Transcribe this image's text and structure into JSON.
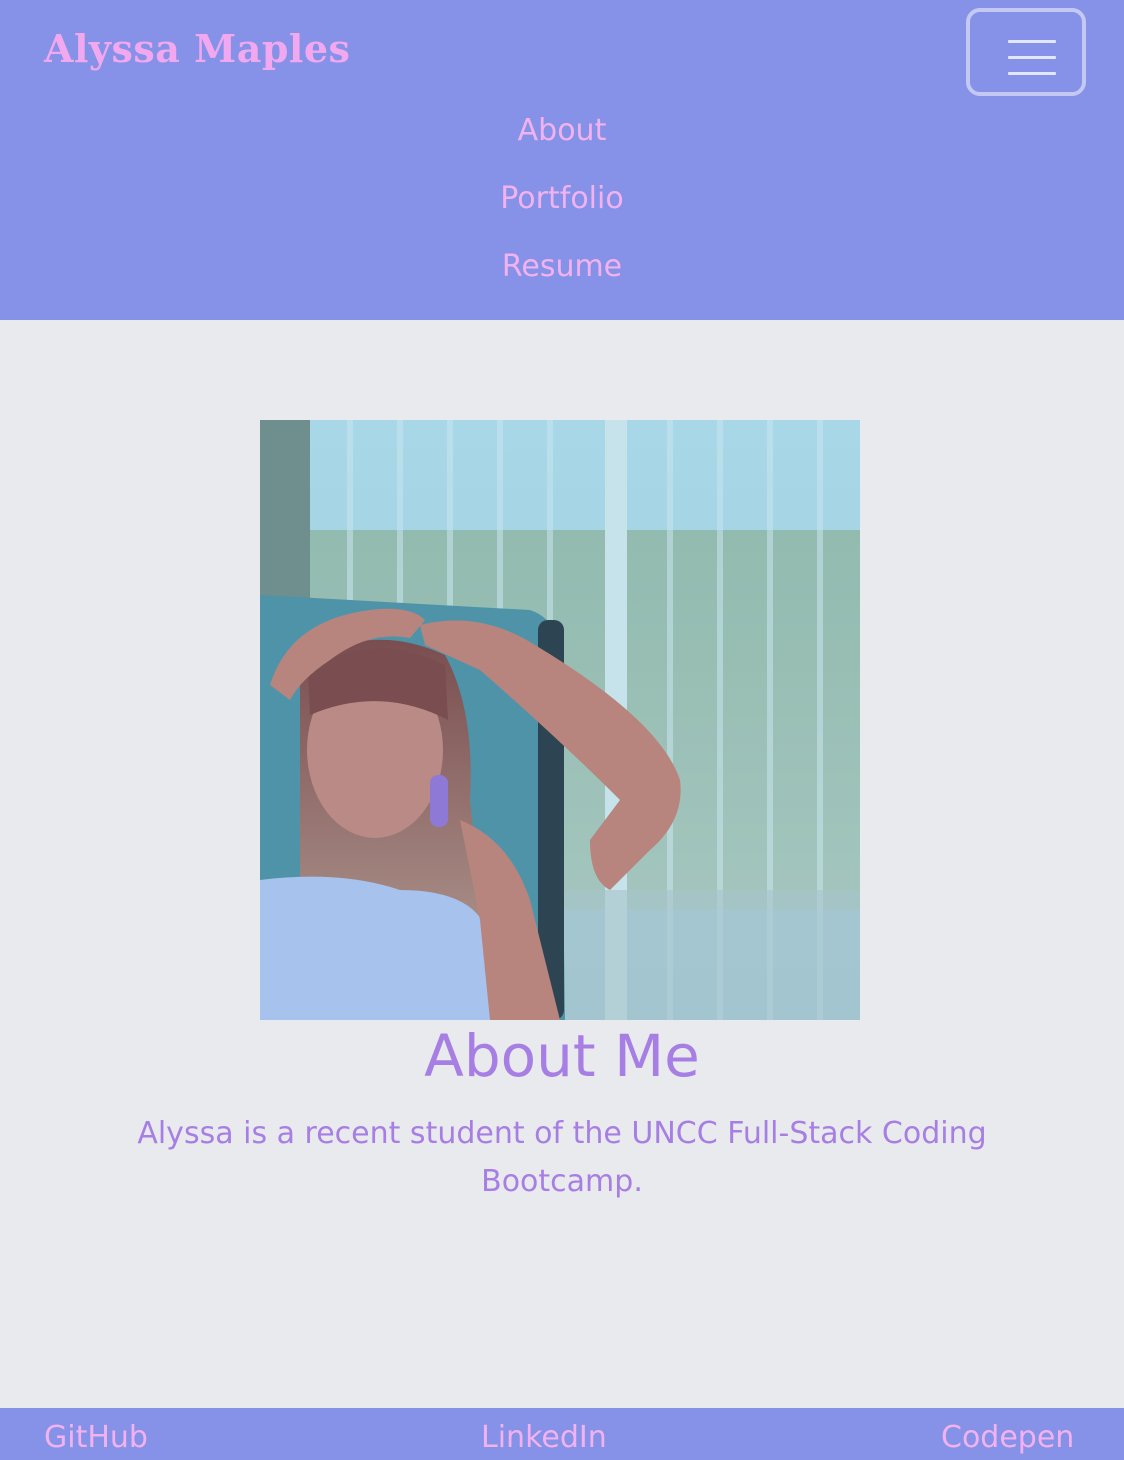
{
  "navbar": {
    "brand": "Alyssa Maples",
    "menu_icon": "hamburger-menu-icon",
    "links": [
      "About",
      "Portfolio",
      "Resume"
    ]
  },
  "about": {
    "title": "About Me",
    "text": "Alyssa is a recent student of the UNCC Full-Stack Coding Bootcamp."
  },
  "footer": {
    "links": [
      "GitHub",
      "LinkedIn",
      "Codepen"
    ]
  },
  "colors": {
    "nav_bg": "#8691e8",
    "page_bg": "#e9eaed",
    "pink_accent": "#f2a8ef",
    "purple_text": "#a77fe4"
  }
}
